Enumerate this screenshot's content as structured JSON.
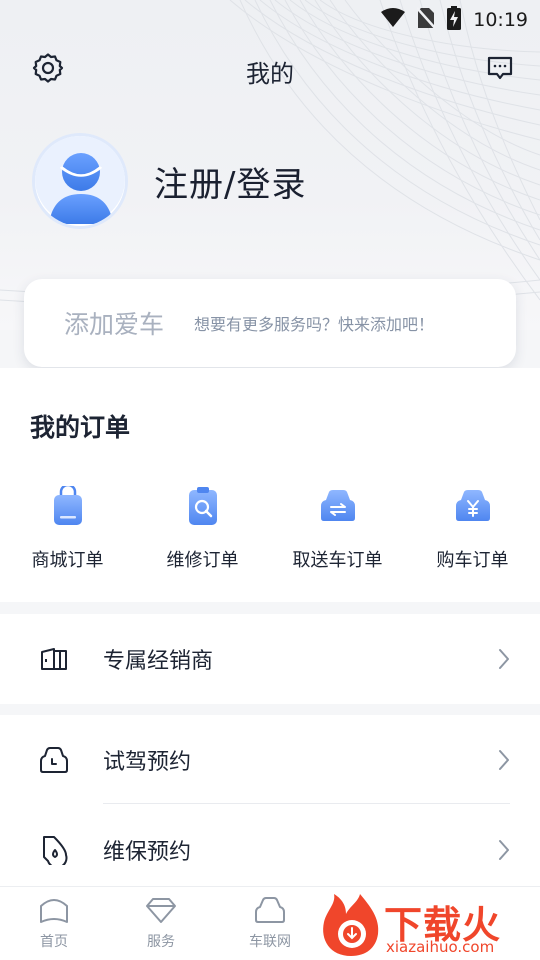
{
  "status_bar": {
    "time": "10:19",
    "icons": [
      "wifi-icon",
      "no-sim-icon",
      "battery-charging-icon"
    ]
  },
  "header": {
    "title": "我的",
    "left_icon": "gear-icon",
    "right_icon": "message-icon"
  },
  "profile": {
    "login_label": "注册/登录",
    "avatar_icon": "avatar-icon"
  },
  "car_card": {
    "title": "添加爱车",
    "hint": "想要有更多服务吗？快来添加吧！"
  },
  "orders": {
    "title": "我的订单",
    "items": [
      {
        "label": "商城订单",
        "icon": "shopping-bag-icon"
      },
      {
        "label": "维修订单",
        "icon": "repair-clipboard-icon"
      },
      {
        "label": "取送车订单",
        "icon": "car-pickup-icon"
      },
      {
        "label": "购车订单",
        "icon": "car-purchase-icon"
      }
    ]
  },
  "menu": [
    {
      "label": "专属经销商",
      "icon": "dealer-icon"
    },
    {
      "label": "试驾预约",
      "icon": "test-drive-icon"
    },
    {
      "label": "维保预约",
      "icon": "maintenance-icon"
    }
  ],
  "tabbar": [
    {
      "label": "首页",
      "icon": "home-icon"
    },
    {
      "label": "服务",
      "icon": "diamond-icon"
    },
    {
      "label": "车联网",
      "icon": "car-icon"
    }
  ],
  "watermark": {
    "title": "下载火",
    "subtitle": "xiazaihuo.com"
  },
  "colors": {
    "accent": "#5b8def",
    "icon_gradient_top": "#8fb7ff",
    "icon_gradient_bottom": "#4f86f0",
    "text_primary": "#1d2433",
    "watermark": "#f0462b"
  }
}
